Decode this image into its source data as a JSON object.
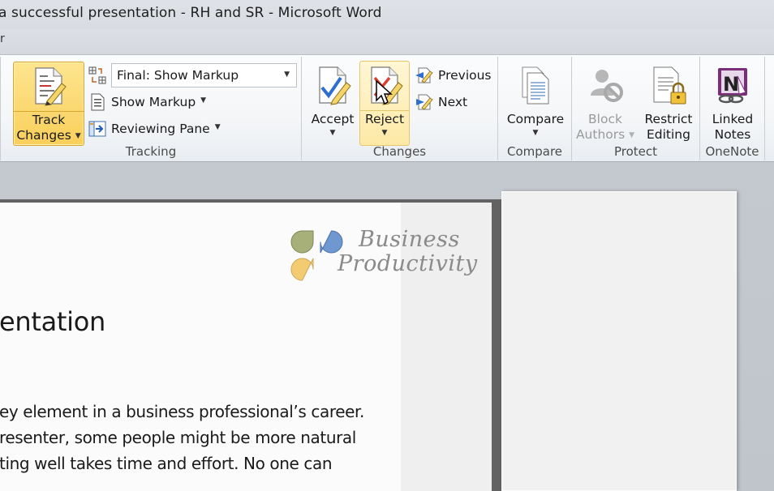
{
  "window": {
    "title": "a successful presentation - RH and SR  -  Microsoft Word",
    "tab_fragment": "r"
  },
  "ribbon": {
    "groups": {
      "tracking": {
        "label": "Tracking",
        "track_changes": {
          "line1": "Track",
          "line2": "Changes"
        },
        "display_for_review": {
          "value": "Final: Show Markup"
        },
        "show_markup": "Show Markup",
        "reviewing_pane": "Reviewing Pane"
      },
      "changes": {
        "label": "Changes",
        "accept": "Accept",
        "reject": "Reject",
        "previous": "Previous",
        "next": "Next"
      },
      "compare": {
        "label": "Compare",
        "compare": "Compare"
      },
      "protect": {
        "label": "Protect",
        "block_authors": {
          "line1": "Block",
          "line2": "Authors"
        },
        "restrict_editing": {
          "line1": "Restrict",
          "line2": "Editing"
        }
      },
      "onenote": {
        "label": "OneNote",
        "linked_notes": {
          "line1": "Linked",
          "line2": "Notes"
        }
      }
    }
  },
  "document": {
    "logo": {
      "line1": "Business",
      "line2": "Productivity"
    },
    "heading": "entation",
    "lines": [
      "ey element in a business professional’s career.",
      "resenter, some people might be more natural",
      "ting well takes time and effort. No one can"
    ]
  },
  "colors": {
    "track_active": "#f9cf5b",
    "reject_hover": "#fde9a6",
    "logo_green": "#a8b07a",
    "logo_blue": "#6f97d0",
    "logo_yellow": "#f2c45a"
  }
}
